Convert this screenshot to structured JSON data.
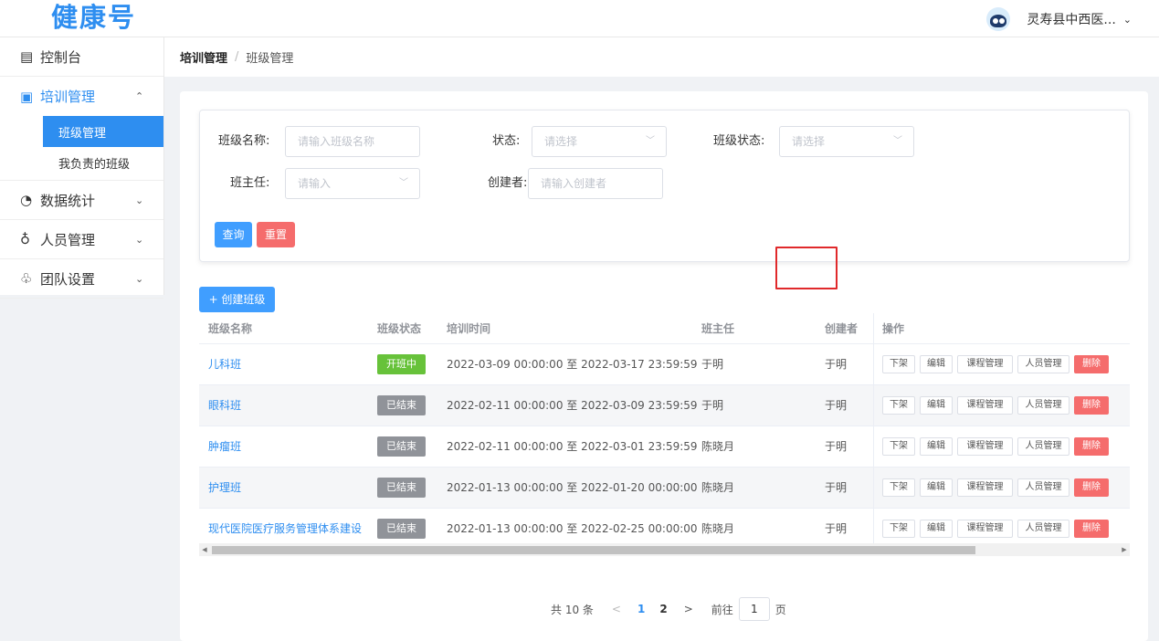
{
  "header": {
    "logo": "健康号",
    "user_name": "灵寿县中西医...",
    "user_chevron": "⌄"
  },
  "sidebar": {
    "items": [
      {
        "label": "控制台",
        "icon": "monitor-icon",
        "glyph": "▤"
      },
      {
        "label": "培训管理",
        "icon": "book-icon",
        "glyph": "▣",
        "chevron": "⌃"
      },
      {
        "label": "数据统计",
        "icon": "chart-icon",
        "glyph": "◔",
        "chevron": "⌄"
      },
      {
        "label": "人员管理",
        "icon": "users-icon",
        "glyph": "♁",
        "chevron": "⌄"
      },
      {
        "label": "团队设置",
        "icon": "team-icon",
        "glyph": "♧",
        "chevron": "⌄"
      }
    ],
    "sub_items": [
      "班级管理",
      "我负责的班级"
    ]
  },
  "breadcrumb": {
    "parent": "培训管理",
    "separator": "/",
    "current": "班级管理"
  },
  "filter": {
    "class_name_label": "班级名称:",
    "class_name_placeholder": "请输入班级名称",
    "status_label": "状态:",
    "status_placeholder": "请选择",
    "class_status_label": "班级状态:",
    "class_status_placeholder": "请选择",
    "head_teacher_label": "班主任:",
    "head_teacher_placeholder": "请输入",
    "creator_label": "创建者:",
    "creator_placeholder": "请输入创建者",
    "query_button": "查询",
    "reset_button": "重置"
  },
  "create_button": "+ 创建班级",
  "table": {
    "headers": [
      "班级名称",
      "班级状态",
      "培训时间",
      "班主任",
      "创建者",
      "操作"
    ],
    "rows": [
      {
        "name": "儿科班",
        "status": "开班中",
        "status_color": "green",
        "time": "2022-03-09 00:00:00 至 2022-03-17 23:59:59",
        "teacher": "于明",
        "creator": "于明"
      },
      {
        "name": "眼科班",
        "status": "已结束",
        "status_color": "grey",
        "time": "2022-02-11 00:00:00 至 2022-03-09 23:59:59",
        "teacher": "于明",
        "creator": "于明"
      },
      {
        "name": "肿瘤班",
        "status": "已结束",
        "status_color": "grey",
        "time": "2022-02-11 00:00:00 至 2022-03-01 23:59:59",
        "teacher": "陈晓月",
        "creator": "于明"
      },
      {
        "name": "护理班",
        "status": "已结束",
        "status_color": "grey",
        "time": "2022-01-13 00:00:00 至 2022-01-20 00:00:00",
        "teacher": "陈晓月",
        "creator": "于明"
      },
      {
        "name": "现代医院医疗服务管理体系建设",
        "status": "已结束",
        "status_color": "grey",
        "time": "2022-01-13 00:00:00 至 2022-02-25 00:00:00",
        "teacher": "陈晓月",
        "creator": "于明"
      }
    ],
    "actions": [
      "下架",
      "编辑",
      "课程管理",
      "人员管理",
      "删除"
    ]
  },
  "pagination": {
    "total": "共 10 条",
    "prev": "<",
    "pages": [
      "1",
      "2"
    ],
    "next": ">",
    "goto_label": "前往",
    "goto_value": "1",
    "page_suffix": "页"
  },
  "colors": {
    "primary": "#409eff",
    "danger": "#f56c6c",
    "success": "#67c23a",
    "info": "#909399",
    "highlight": "#e0292b"
  }
}
